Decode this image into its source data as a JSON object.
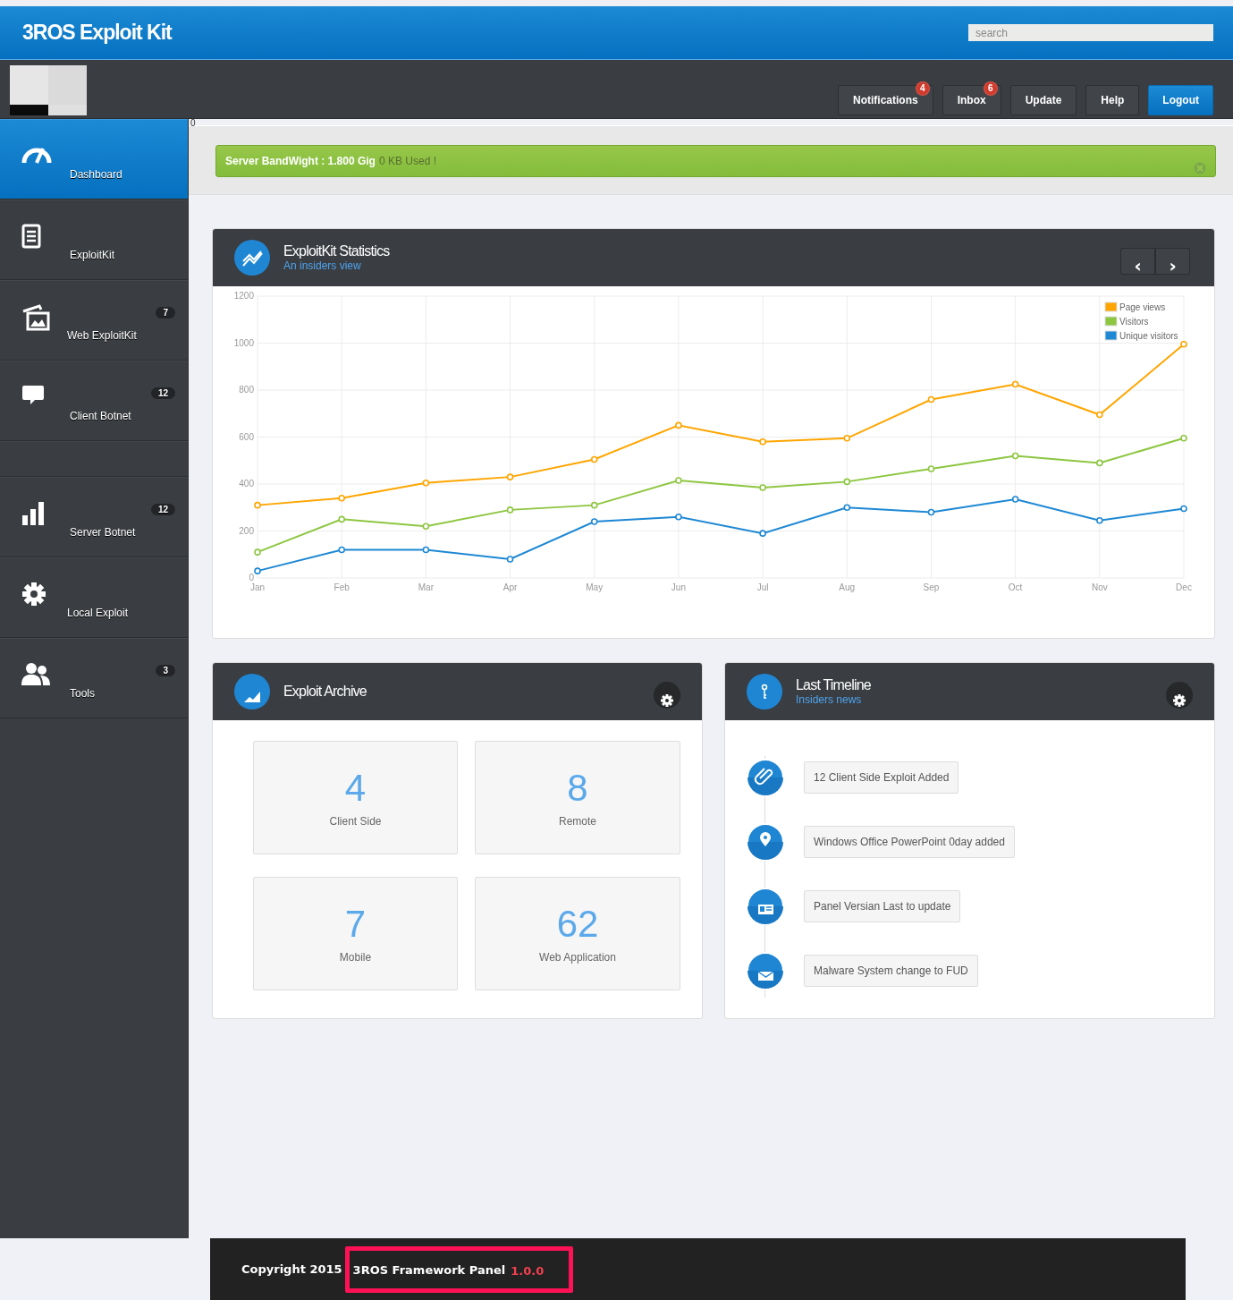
{
  "header": {
    "title": "3ROS Exploit Kit",
    "search": {
      "placeholder": "search"
    }
  },
  "toolbar": {
    "buttons": [
      {
        "label": "Notifications",
        "badge": "4",
        "primary": false
      },
      {
        "label": "Inbox",
        "badge": "6",
        "primary": false
      },
      {
        "label": "Update",
        "primary": false
      },
      {
        "label": "Help",
        "primary": false
      },
      {
        "label": "Logout",
        "primary": true
      }
    ]
  },
  "stray_text": "0",
  "sidebar": {
    "items": [
      {
        "kind": "link",
        "label": "Dashboard",
        "selected": true
      },
      {
        "kind": "link",
        "label": "ExploitKit",
        "selected": false
      },
      {
        "kind": "link",
        "label": "Web ExploitKit",
        "badge": "7",
        "selected": false
      },
      {
        "kind": "link",
        "label": "Client Botnet",
        "badge": "12",
        "selected": false
      },
      {
        "kind": "spacer"
      },
      {
        "kind": "link",
        "label": "Server Botnet",
        "badge": "12",
        "selected": false
      },
      {
        "kind": "link",
        "label": "Local Exploit",
        "selected": false
      },
      {
        "kind": "link",
        "label": "Tools",
        "badge": "3",
        "selected": false
      }
    ]
  },
  "alert": {
    "label": "Server BandWight : 1.800 Gig",
    "detail": "0 KB Used !"
  },
  "stats_card": {
    "title": "ExploitKit Statistics",
    "subtitle": "An insiders view",
    "prev": "‹",
    "next": "›",
    "chart_data": {
      "type": "line",
      "categories": [
        "Jan",
        "Feb",
        "Mar",
        "Apr",
        "May",
        "Jun",
        "Jul",
        "Aug",
        "Sep",
        "Oct",
        "Nov",
        "Dec"
      ],
      "ylim": [
        0,
        1200
      ],
      "grid": true,
      "legend": true,
      "yticks": [
        0,
        200,
        400,
        600,
        800,
        1000,
        1200
      ],
      "series": [
        {
          "name": "Page views",
          "color": "#ffa500",
          "marker": "circle",
          "values": [
            310,
            340,
            405,
            430,
            505,
            650,
            580,
            595,
            760,
            825,
            695,
            995
          ]
        },
        {
          "name": "Visitors",
          "color": "#8dc641",
          "marker": "circle",
          "values": [
            110,
            250,
            220,
            290,
            310,
            415,
            385,
            410,
            465,
            520,
            490,
            595
          ]
        },
        {
          "name": "Unique visitors",
          "color": "#1e88d4",
          "marker": "circle",
          "values": [
            30,
            120,
            120,
            80,
            240,
            260,
            190,
            300,
            280,
            335,
            245,
            295
          ]
        }
      ]
    }
  },
  "archive": {
    "title": "Exploit Archive",
    "tiles": [
      {
        "value": "4",
        "label": "Client Side"
      },
      {
        "value": "8",
        "label": "Remote"
      },
      {
        "value": "7",
        "label": "Mobile"
      },
      {
        "value": "62",
        "label": "Web Application"
      }
    ]
  },
  "timeline": {
    "title": "Last Timeline",
    "subtitle": "Insiders news",
    "events": [
      "12 Client Side Exploit Added",
      "Windows Office PowerPoint 0day added",
      "Panel Versian Last to update",
      "Malware System change to FUD"
    ]
  },
  "footer": {
    "copyright": "Copyright 2015",
    "product": "3ROS Framework Panel",
    "version": "1.0.0"
  }
}
